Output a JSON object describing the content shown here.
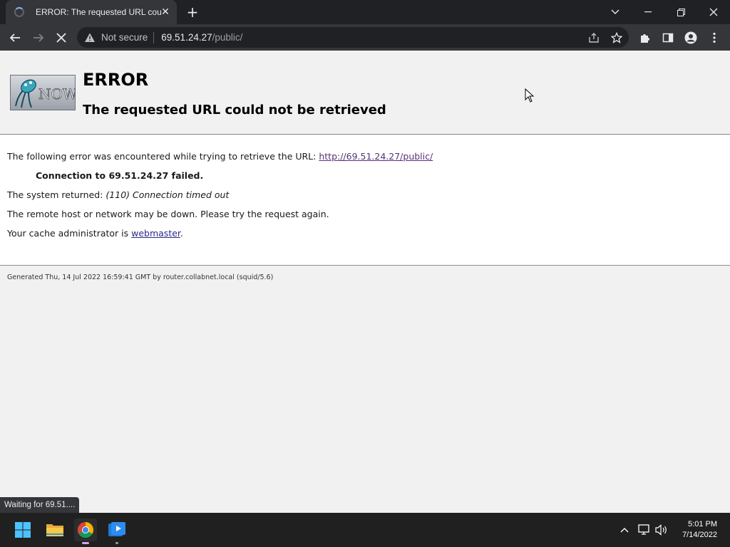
{
  "browser": {
    "tab_title": "ERROR: The requested URL could not be retrieved",
    "url_security": "Not secure",
    "url_host": "69.51.24.27",
    "url_path": "/public/",
    "status_text": "Waiting for 69.51...."
  },
  "page": {
    "heading": "ERROR",
    "subheading": "The requested URL could not be retrieved",
    "logo_text": "NOW",
    "line1_prefix": "The following error was encountered while trying to retrieve the URL: ",
    "line1_link": "http://69.51.24.27/public/",
    "line2": "Connection to 69.51.24.27 failed.",
    "line3_prefix": "The system returned: ",
    "line3_italic": "(110) Connection timed out",
    "line4": "The remote host or network may be down. Please try the request again.",
    "line5_prefix": "Your cache administrator is ",
    "line5_link": "webmaster",
    "line5_suffix": ".",
    "footer": "Generated Thu, 14 Jul 2022 16:59:41 GMT by router.collabnet.local (squid/5.6)"
  },
  "taskbar": {
    "time": "5:01 PM",
    "date": "7/14/2022",
    "apps": [
      "start-icon",
      "file-explorer-icon",
      "chrome-icon",
      "media-app-icon"
    ]
  },
  "colors": {
    "chrome_dark": "#202124",
    "chrome_toolbar": "#35363a",
    "link": "#2b2b8c",
    "visited_link": "#57307a"
  }
}
